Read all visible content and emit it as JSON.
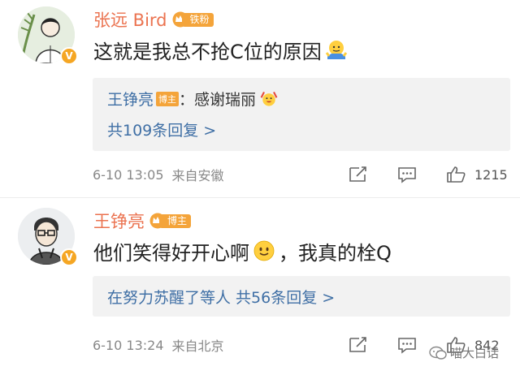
{
  "comments": [
    {
      "username": "张远 Bird",
      "badge": "铁粉",
      "text": "这就是我总不抢C位的原因",
      "text_emoji": "shrug-emoji",
      "reply": {
        "author": "王铮亮",
        "author_tag": "博主",
        "content": "：感谢瑞丽",
        "content_emoji": "cheer-emoji",
        "more_link": "共109条回复 >"
      },
      "time": "6-10 13:05",
      "source": "来自安徽",
      "likes": "1215"
    },
    {
      "username": "王铮亮",
      "badge": "博主",
      "text_before": "他们笑得好开心啊",
      "text_emoji": "smile-emoji",
      "text_after": "，我真的栓Q",
      "reply_summary": "在努力苏醒了等人  共56条回复 >",
      "time": "6-10 13:24",
      "source": "来自北京",
      "likes": "842"
    }
  ],
  "watermark": "喵大白话",
  "colors": {
    "username": "#eb7350",
    "link": "#3f6fa5",
    "badge": "#f4a43a",
    "verified": "#f5a623",
    "meta": "#888888"
  }
}
